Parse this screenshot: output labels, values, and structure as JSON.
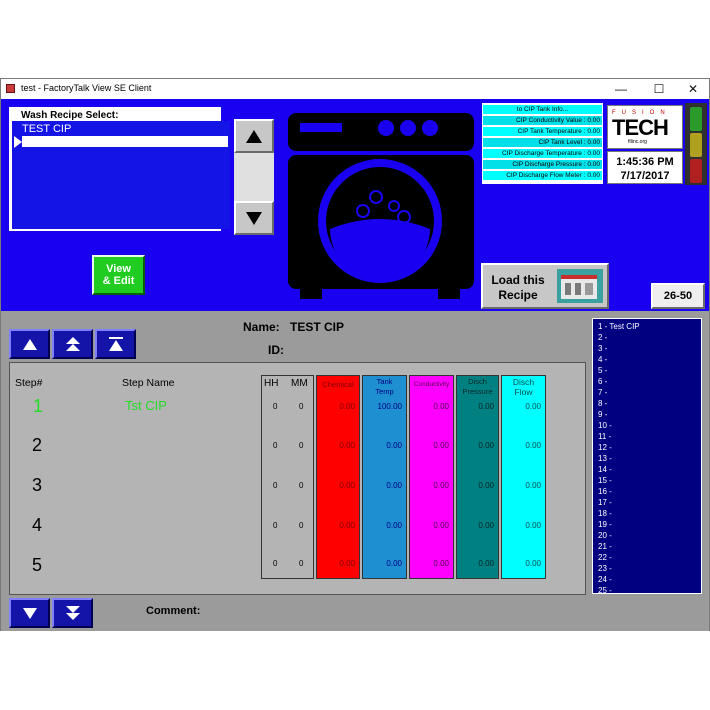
{
  "window": {
    "title": "test - FactoryTalk View SE Client",
    "minimize": "—",
    "maximize": "☐",
    "close": "✕"
  },
  "recipe_select": {
    "label": "Wash Recipe Select:",
    "selected": "TEST CIP"
  },
  "view_edit": {
    "line1": "View",
    "line2": "& Edit"
  },
  "info": {
    "header": "to CIP Tank Info...",
    "rows": [
      "CIP Conductivity Value : 0.00",
      "CIP Tank Temperature : 0.00",
      "CIP Tank Level : 0.00",
      "CIP Discharge Temperature : 0.00",
      "CIP Discharge Pressure : 0.00",
      "CIP Discharge Flow Meter : 0.00"
    ]
  },
  "logo": {
    "line1": "FUSION",
    "line2": "TECH",
    "line3": "ftlinc.org"
  },
  "clock": {
    "time": "1:45:36 PM",
    "date": "7/17/2017"
  },
  "load_recipe": {
    "line1": "Load this",
    "line2": "Recipe"
  },
  "page_button": {
    "label": "26-50"
  },
  "recipe_header": {
    "name_label": "Name:",
    "name_value": "TEST CIP",
    "id_label": "ID:"
  },
  "columns": {
    "step": "Step#",
    "step_name": "Step Name",
    "hh": "HH",
    "mm": "MM",
    "data": [
      {
        "label": "Chemical",
        "color": "#ff0000",
        "text_color": "#800000"
      },
      {
        "label": "Tank\nTemp",
        "color": "#1e90d2",
        "text_color": "#000080"
      },
      {
        "label": "Conductivity",
        "color": "#ff00ff",
        "text_color": "#500050"
      },
      {
        "label": "Disch\nPressure",
        "color": "#008080",
        "text_color": "#002828"
      },
      {
        "label": "Disch\nFlow",
        "color": "#00ffff",
        "text_color": "#005050"
      }
    ]
  },
  "steps": [
    {
      "num": "1",
      "name": "Tst CIP",
      "hh": "0",
      "mm": "0",
      "values": [
        "0.00",
        "100.00",
        "0.00",
        "0.00",
        "0.00"
      ]
    },
    {
      "num": "2",
      "name": "",
      "hh": "0",
      "mm": "0",
      "values": [
        "0.00",
        "0.00",
        "0.00",
        "0.00",
        "0.00"
      ]
    },
    {
      "num": "3",
      "name": "",
      "hh": "0",
      "mm": "0",
      "values": [
        "0.00",
        "0.00",
        "0.00",
        "0.00",
        "0.00"
      ]
    },
    {
      "num": "4",
      "name": "",
      "hh": "0",
      "mm": "0",
      "values": [
        "0.00",
        "0.00",
        "0.00",
        "0.00",
        "0.00"
      ]
    },
    {
      "num": "5",
      "name": "",
      "hh": "0",
      "mm": "0",
      "values": [
        "0.00",
        "0.00",
        "0.00",
        "0.00",
        "0.00"
      ]
    }
  ],
  "comment": {
    "label": "Comment:"
  },
  "step_index": [
    "1 - Test CIP",
    "2 -",
    "3 -",
    "4 -",
    "5 -",
    "6 -",
    "7 -",
    "8 -",
    "9 -",
    "10 -",
    "11 -",
    "12 -",
    "13 -",
    "14 -",
    "15 -",
    "16 -",
    "17 -",
    "18 -",
    "19 -",
    "20 -",
    "21 -",
    "22 -",
    "23 -",
    "24 -",
    "25 -"
  ],
  "colors": {
    "screen_blue": "#1a00f0",
    "panel_gray": "#9b9b9b",
    "step1_green": "#22dd22"
  }
}
